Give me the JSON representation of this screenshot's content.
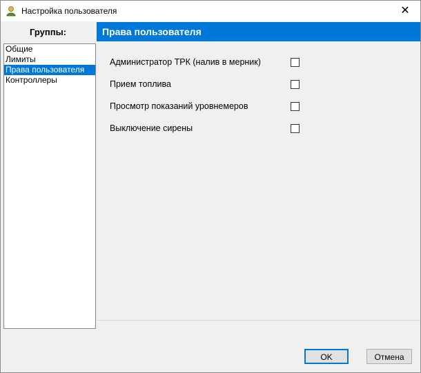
{
  "window": {
    "title": "Настройка пользователя"
  },
  "titlebar": {
    "close_glyph": "✕",
    "app_icon": "user-icon"
  },
  "groups": {
    "header": "Группы:",
    "items": [
      {
        "label": "Общие",
        "selected": false
      },
      {
        "label": "Лимиты",
        "selected": false
      },
      {
        "label": "Права пользователя",
        "selected": true
      },
      {
        "label": "Контроллеры",
        "selected": false
      }
    ]
  },
  "section": {
    "title": "Права пользователя"
  },
  "rights": [
    {
      "label": "Администратор ТРК (налив в мерник)",
      "checked": false
    },
    {
      "label": "Прием топлива",
      "checked": false
    },
    {
      "label": "Просмотр показаний уровнемеров",
      "checked": false
    },
    {
      "label": "Выключение сирены",
      "checked": false
    }
  ],
  "buttons": {
    "ok": "OK",
    "cancel": "Отмена"
  },
  "colors": {
    "accent": "#0078d7",
    "panel": "#f0f0f0"
  }
}
